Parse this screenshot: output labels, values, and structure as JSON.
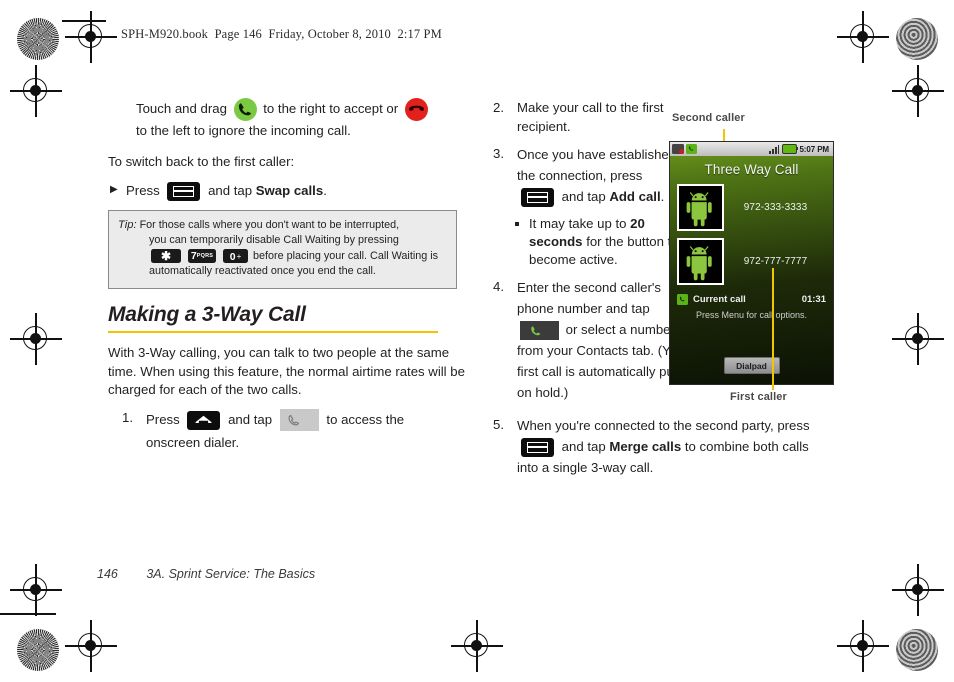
{
  "header": {
    "text": "SPH-M920.book  Page 146  Friday, October 8, 2010  2:17 PM"
  },
  "left_column": {
    "intro": {
      "part1": "Touch and drag",
      "accept_icon": "green-answer-call-icon",
      "part2": "to the right to accept or",
      "ignore_icon": "red-end-call-icon",
      "part3": "to the left to ignore the incoming call."
    },
    "switch_back_lead": "To switch back to the first caller:",
    "switch_back_step": {
      "marker": "▶",
      "part1": "Press",
      "key_icon": "menu-key-icon",
      "part2": "and tap",
      "bold": "Swap calls",
      "part3": "."
    },
    "tip": {
      "label": "Tip:",
      "line1": "For those calls where you don't want to be interrupted,",
      "line2": "you can temporarily disable Call Waiting by pressing",
      "keys": [
        {
          "name": "star-key",
          "main": "✱",
          "sub": "",
          "plus": ""
        },
        {
          "name": "seven-pqrs-key",
          "main": "7",
          "sub": "PQRS",
          "plus": ""
        },
        {
          "name": "zero-plus-key",
          "main": "0",
          "sub": "",
          "plus": "+"
        }
      ],
      "line3": "before placing your call. Call Waiting is",
      "line4": "automatically reactivated once you end the call."
    },
    "section": {
      "heading": "Making a 3-Way Call",
      "rule_color": "#f2c500",
      "body": "With 3-Way calling, you can talk to two people at the same time. When using this feature, the normal airtime rates will be charged for each of the two calls."
    },
    "step1": {
      "marker": "1.",
      "part1": "Press",
      "home_icon": "home-key-icon",
      "part2": "and tap",
      "dialer_icon": "dialer-button-icon",
      "part3": "to access the",
      "line2": "onscreen dialer."
    }
  },
  "right_column": {
    "step2": {
      "marker": "2.",
      "text": "Make your call to the first recipient."
    },
    "step3": {
      "marker": "3.",
      "part1": "Once you have established the connection, press",
      "key_icon": "menu-key-icon",
      "part2": "and tap",
      "bold": "Add call",
      "part3": "."
    },
    "step3_sub": {
      "marker": "▪",
      "part1": "It may take up to",
      "bold": "20 seconds",
      "part2": "for the button to become active."
    },
    "step4": {
      "marker": "4.",
      "part1": "Enter the second caller's phone number and tap",
      "call_icon": "call-button-icon",
      "part2": "or select a number from your Contacts tab. (Your first call is automatically put on hold.)"
    },
    "step5": {
      "marker": "5.",
      "part1": "When you're connected to the second party, press",
      "key_icon": "menu-key-icon",
      "part2": "and tap",
      "bold": "Merge calls",
      "part3": "to combine both calls into a single 3-way call."
    }
  },
  "phone": {
    "callout_second": "Second caller",
    "callout_first": "First caller",
    "status_bar": {
      "icons": [
        "message-icon",
        "call-active-icon",
        "signal-bars-icon",
        "battery-icon"
      ],
      "time": "5:07 PM"
    },
    "title": "Three Way Call",
    "callers": [
      {
        "avatar": "android-robot-avatar",
        "number": "972-333-3333"
      },
      {
        "avatar": "android-robot-avatar",
        "number": "972-777-7777"
      }
    ],
    "current_call": {
      "icon": "green-call-icon",
      "label": "Current call",
      "timer": "01:31"
    },
    "hint": "Press Menu for call options.",
    "dialpad_button": "Dialpad"
  },
  "footer": {
    "page": "146",
    "section": "3A. Sprint Service: The Basics"
  }
}
